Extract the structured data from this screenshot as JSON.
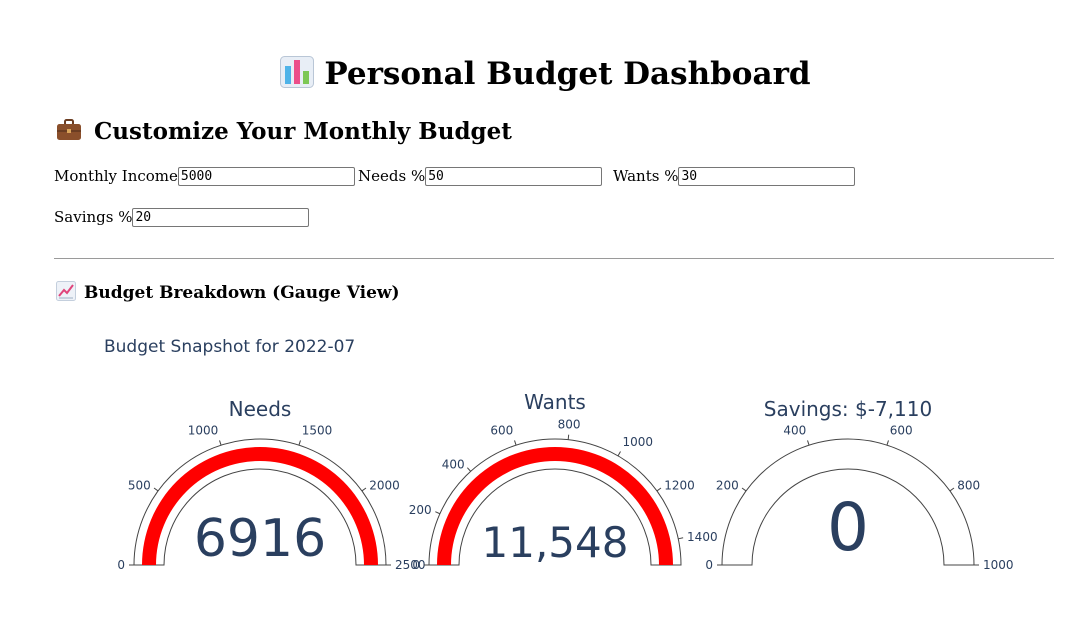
{
  "header": {
    "title": "Personal Budget Dashboard",
    "icon": "bar-chart-icon"
  },
  "customize": {
    "title": "Customize Your Monthly Budget",
    "icon": "briefcase-icon",
    "fields": {
      "income": {
        "label": "Monthly Income",
        "value": "5000"
      },
      "needs": {
        "label": "Needs %",
        "value": "50"
      },
      "wants": {
        "label": "Wants %",
        "value": "30"
      },
      "savings": {
        "label": "Savings %",
        "value": "20"
      }
    }
  },
  "breakdown": {
    "title": "Budget Breakdown (Gauge View)",
    "icon": "chart-increasing-icon"
  },
  "chart_data": {
    "type": "gauge",
    "title": "Budget Snapshot for 2022-07",
    "colors": {
      "bar": "#ff0000",
      "text": "#2a3f5f",
      "outline": "#444444"
    },
    "gauges": [
      {
        "name": "Needs",
        "title": "Needs",
        "value": 6916,
        "value_label": "6916",
        "range": [
          0,
          2500
        ],
        "ticks": [
          0,
          500,
          1000,
          1500,
          2000,
          2500
        ],
        "tick_labels": [
          "0",
          "500",
          "1000",
          "1500",
          "2000",
          "2500"
        ]
      },
      {
        "name": "Wants",
        "title": "Wants",
        "value": 11548,
        "value_label": "11,548",
        "range": [
          0,
          1500
        ],
        "ticks": [
          0,
          200,
          400,
          600,
          800,
          1000,
          1200,
          1400
        ],
        "tick_labels": [
          "0",
          "200",
          "400",
          "600",
          "800",
          "1000",
          "1200",
          "1400"
        ]
      },
      {
        "name": "Savings",
        "title": "Savings: $-7,110",
        "value": 0,
        "value_label": "0",
        "range": [
          0,
          1000
        ],
        "ticks": [
          0,
          200,
          400,
          600,
          800,
          1000
        ],
        "tick_labels": [
          "0",
          "200",
          "400",
          "600",
          "800",
          "1000"
        ]
      }
    ]
  }
}
